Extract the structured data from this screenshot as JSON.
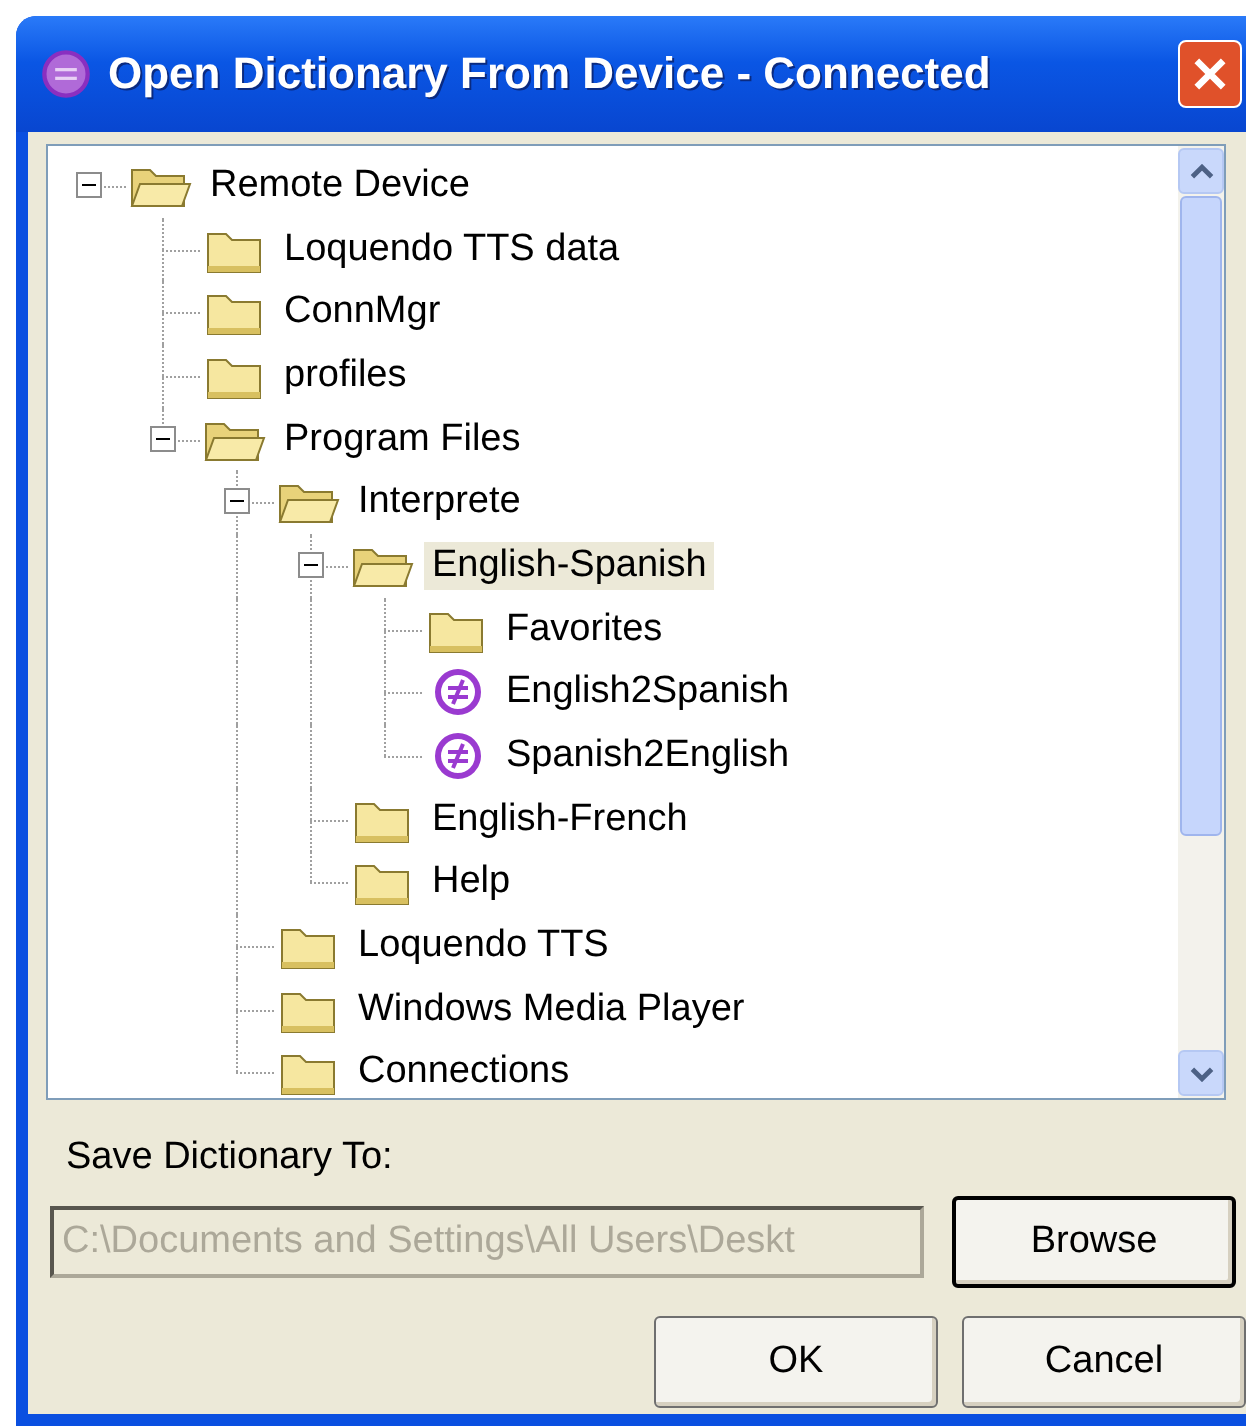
{
  "window": {
    "title": "Open Dictionary From Device - Connected"
  },
  "tree": [
    {
      "label": "Remote Device",
      "kind": "folder",
      "expanded": true,
      "selected": false,
      "children": [
        {
          "label": "Loquendo TTS data",
          "kind": "folder",
          "selected": false
        },
        {
          "label": "ConnMgr",
          "kind": "folder",
          "selected": false
        },
        {
          "label": "profiles",
          "kind": "folder",
          "selected": false
        },
        {
          "label": "Program Files",
          "kind": "folder",
          "expanded": true,
          "selected": false,
          "children": [
            {
              "label": "Interprete",
              "kind": "folder",
              "expanded": true,
              "selected": false,
              "children": [
                {
                  "label": "English-Spanish",
                  "kind": "folder",
                  "expanded": true,
                  "selected": true,
                  "children": [
                    {
                      "label": "Favorites",
                      "kind": "folder",
                      "selected": false
                    },
                    {
                      "label": "English2Spanish",
                      "kind": "dictionary",
                      "selected": false
                    },
                    {
                      "label": "Spanish2English",
                      "kind": "dictionary",
                      "selected": false
                    }
                  ]
                },
                {
                  "label": "English-French",
                  "kind": "folder",
                  "selected": false
                },
                {
                  "label": "Help",
                  "kind": "folder",
                  "selected": false
                }
              ]
            },
            {
              "label": "Loquendo TTS",
              "kind": "folder",
              "selected": false
            },
            {
              "label": "Windows Media Player",
              "kind": "folder",
              "selected": false
            },
            {
              "label": "Connections",
              "kind": "folder",
              "selected": false
            }
          ]
        }
      ]
    }
  ],
  "save_to": {
    "label": "Save Dictionary To:",
    "value": "C:\\Documents and Settings\\All Users\\Deskt",
    "disabled": true
  },
  "buttons": {
    "browse": "Browse",
    "ok": "OK",
    "cancel": "Cancel"
  }
}
